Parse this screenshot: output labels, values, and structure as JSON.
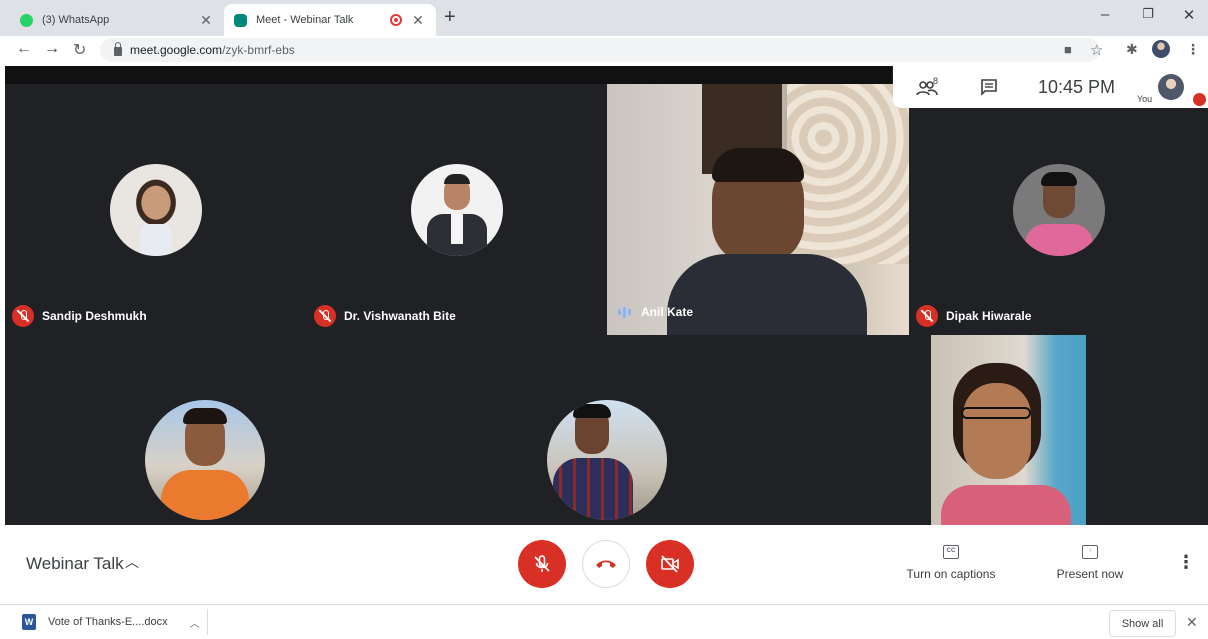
{
  "browser": {
    "tabs": [
      {
        "title": "(3) WhatsApp",
        "favicon": "whatsapp-icon",
        "active": false
      },
      {
        "title": "Meet - Webinar Talk",
        "favicon": "google-meet-icon",
        "active": true,
        "recording": true
      }
    ],
    "url_domain": "meet.google.com",
    "url_path": "/zyk-bmrf-ebs"
  },
  "meet": {
    "participant_count": "8",
    "clock": "10:45 PM",
    "self_label": "You",
    "participants": [
      {
        "name": "Sandip Deshmukh",
        "muted": true
      },
      {
        "name": "Dr. Vishwanath Bite",
        "muted": true
      },
      {
        "name": "Anil Kate",
        "muted": false,
        "speaking": true
      },
      {
        "name": "Dipak Hiwarale",
        "muted": true
      },
      {
        "name": "",
        "muted": true
      },
      {
        "name": "",
        "muted": true
      },
      {
        "name": "",
        "muted": false
      }
    ],
    "meeting_title": "Webinar Talk",
    "actions": {
      "captions": "Turn on captions",
      "present": "Present now",
      "captions_icon_text": "CC"
    }
  },
  "downloads": {
    "file_name": "Vote of Thanks-E....docx",
    "show_all": "Show all"
  },
  "colors": {
    "meet_bg": "#202124",
    "danger_red": "#d93025",
    "whatsapp_green": "#25d366",
    "meet_favicon": "#00897b"
  }
}
